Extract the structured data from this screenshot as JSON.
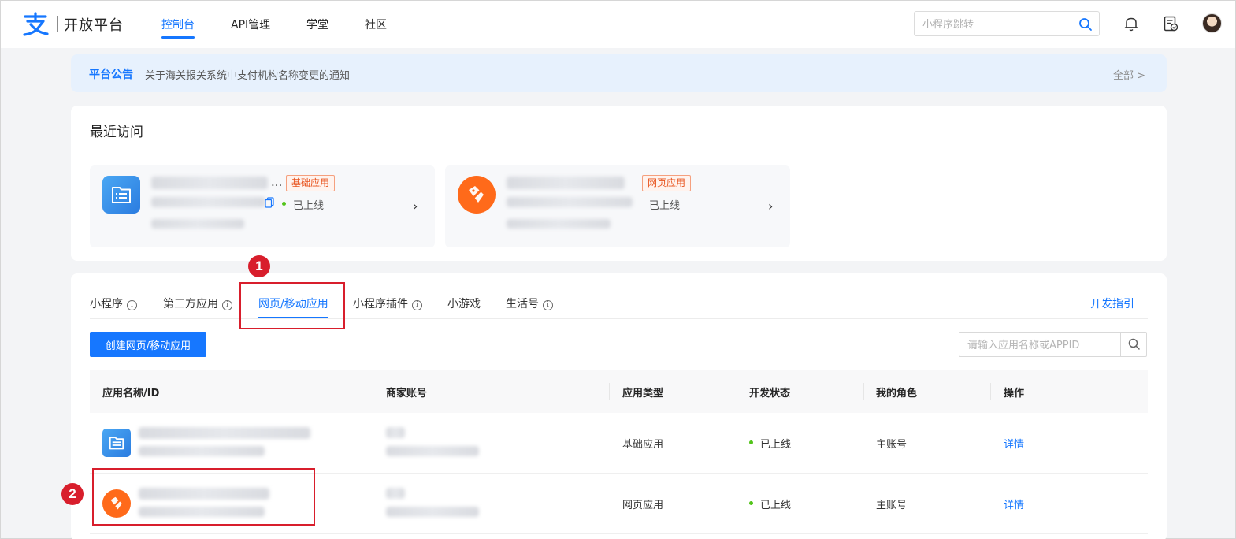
{
  "header": {
    "logo_text": "开放平台",
    "nav": [
      {
        "label": "控制台",
        "active": true
      },
      {
        "label": "API管理",
        "active": false
      },
      {
        "label": "学堂",
        "active": false
      },
      {
        "label": "社区",
        "active": false
      }
    ],
    "search_placeholder": "小程序跳转",
    "icons": [
      "search-icon",
      "bell-icon",
      "document-check-icon",
      "avatar"
    ]
  },
  "notice": {
    "tag": "平台公告",
    "message": "关于海关报关系统中支付机构名称变更的通知",
    "all_link": "全部 >"
  },
  "recent": {
    "title": "最近访问",
    "items": [
      {
        "name_suffix": "...",
        "badge": "基础应用",
        "status": "已上线",
        "icon": "app-list-icon"
      },
      {
        "badge": "网页应用",
        "status": "已上线",
        "icon": "web-app-icon"
      }
    ]
  },
  "apps": {
    "tabs": [
      {
        "label": "小程序",
        "info": true
      },
      {
        "label": "第三方应用",
        "info": true
      },
      {
        "label": "网页/移动应用",
        "info": false,
        "active": true
      },
      {
        "label": "小程序插件",
        "info": true
      },
      {
        "label": "小游戏",
        "info": false
      },
      {
        "label": "生活号",
        "info": true
      }
    ],
    "dev_guide": "开发指引",
    "create_button": "创建网页/移动应用",
    "search_placeholder": "请输入应用名称或APPID",
    "columns": [
      "应用名称/ID",
      "商家账号",
      "应用类型",
      "开发状态",
      "我的角色",
      "操作"
    ],
    "rows": [
      {
        "type": "基础应用",
        "status": "已上线",
        "role": "主账号",
        "action": "详情"
      },
      {
        "type": "网页应用",
        "status": "已上线",
        "role": "主账号",
        "action": "详情"
      }
    ]
  },
  "callouts": [
    "1",
    "2"
  ],
  "colors": {
    "accent": "#1677ff",
    "callout": "#d81e2c",
    "online": "#52c41a",
    "badge": "#e8541e"
  }
}
